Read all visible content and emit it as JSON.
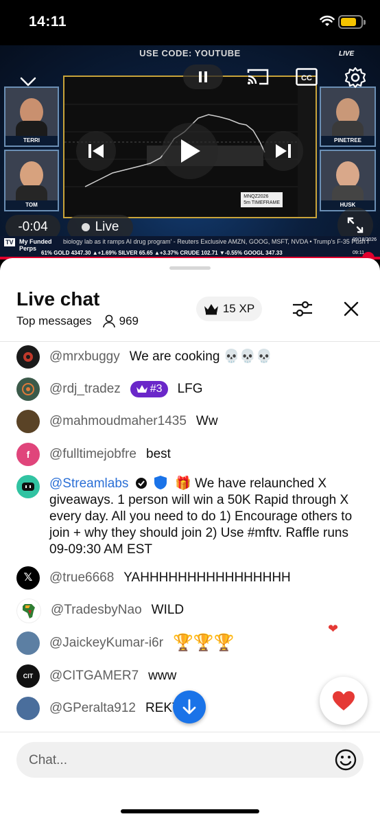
{
  "status_bar": {
    "time": "14:11"
  },
  "video": {
    "overlay_code": "USE CODE: YOUTUBE",
    "cams": [
      {
        "name": "TERRI"
      },
      {
        "name": "TOM"
      },
      {
        "name": "PINETREE"
      },
      {
        "name": "HUSK"
      }
    ],
    "chart_label_1": "MNQZ2026",
    "chart_label_2": "5m TIMEFRAME",
    "time_remaining": "-0:04",
    "live_label": "Live",
    "live_corner": "LIVE",
    "ticker_brand_1": "My Funded",
    "ticker_brand_2": "Perps",
    "ticker_headline": "biology lab as it ramps AI drug program' - Reuters Exclusive  AMZN, GOOG, MSFT, NVDA   •  Trump's F-35 Push f",
    "ticker_quotes": "61%    GOLD 4347.30 ▲+1.69%    SILVER 65.65 ▲+3.37%    CRUDE 102.71 ▼-0.55%    GOOGL 347.33",
    "ticker_date": "09/18/2026",
    "ticker_clock": "09:11",
    "progress": 0.99
  },
  "chat": {
    "title": "Live chat",
    "mode": "Top messages",
    "viewer_count": "969",
    "xp_label": "15 XP",
    "messages": [
      {
        "author": "@mrxbuggy",
        "text": "We are cooking 💀💀💀",
        "avatar_color": "#1a1a1a"
      },
      {
        "author": "@rdj_tradez",
        "badge": "#3",
        "text": "LFG",
        "avatar_color": "#3b5a4a"
      },
      {
        "author": "@mahmoudmaher1435",
        "text": "Ww",
        "avatar_color": "#5a4326"
      },
      {
        "author": "@fulltimejobfre",
        "text": "best",
        "avatar_color": "#e0457b",
        "avatar_letter": "f"
      },
      {
        "author": "@true6668",
        "text": "YAHHHHHHHHHHHHHHHH",
        "avatar_color": "#000000",
        "avatar_letter": "𝕏"
      },
      {
        "author": "@TradesbyNao",
        "text": "WILD",
        "avatar_color": "#2e7d32"
      },
      {
        "author": "@JaickeyKumar-i6r",
        "text": "🏆🏆🏆",
        "avatar_color": "#5c7fa3"
      },
      {
        "author": "@CITGAMER7",
        "text": "www",
        "avatar_color": "#111111",
        "avatar_letter": "CIT"
      },
      {
        "author": "@GPeralta912",
        "text": "REKT!D!!!",
        "avatar_color": "#4a6e9c"
      }
    ],
    "streamlabs": {
      "author": "@Streamlabs",
      "text": "🎁 We have relaunched X giveaways. 1 person will win a 50K Rapid through X every day. All you need to do 1) Encourage others to join + why they should join 2) Use #mftv. Raffle runs 09-09:30 AM EST"
    },
    "input_placeholder": "Chat..."
  }
}
